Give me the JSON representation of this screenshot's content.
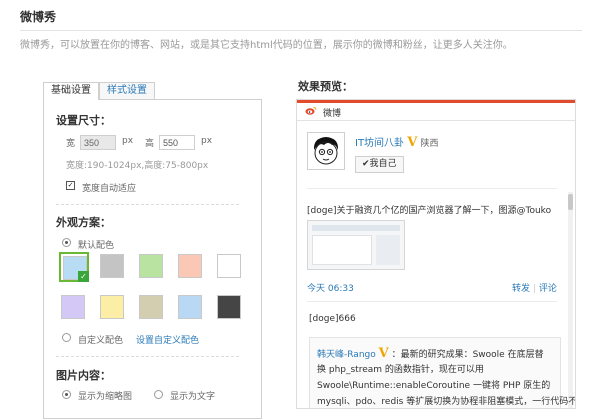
{
  "page": {
    "title": "微博秀",
    "description": "微博秀，可以放置在你的博客、网站，或是其它支持html代码的位置，展示你的微博和粉丝，让更多人关注你。"
  },
  "tabs": [
    {
      "label": "基础设置",
      "active": true
    },
    {
      "label": "样式设置",
      "active": false
    }
  ],
  "size": {
    "title": "设置尺寸：",
    "width_label": "宽",
    "width_value": "350",
    "height_label": "高",
    "height_value": "550",
    "unit": "px",
    "range_hint": "宽度:190-1024px,高度:75-800px",
    "auto_width_label": "宽度自动适应",
    "auto_width_checked": true
  },
  "appearance": {
    "title": "外观方案：",
    "default_label": "默认配色",
    "custom_label": "自定义配色",
    "custom_link": "设置自定义配色",
    "selected": "default",
    "swatches": [
      "#b7dcf4",
      "#c4c4c4",
      "#b9e3a1",
      "#fbc8b6",
      "#ffffff",
      "#d4c8f6",
      "#fdeea5",
      "#d4ceb1",
      "#b9d8f3",
      "#454545"
    ],
    "selected_swatch": 0,
    "check_mark": "✓"
  },
  "images": {
    "title": "图片内容：",
    "thumb_label": "显示为缩略图",
    "text_label": "显示为文字",
    "selected": "thumb"
  },
  "preview": {
    "label": "效果预览：",
    "header": "微博",
    "user_name": "IT坊间八卦",
    "verified_badge": "V",
    "location": "陕西",
    "follow_button": "我自己",
    "post1_text": "[doge]关于融资几个亿的国产浏览器了解一下，图源@Touko",
    "post1_time": "今天 06:33",
    "post_actions": [
      "转发",
      "评论"
    ],
    "action_separator": "|",
    "post2_text": "[doge]666",
    "quote_user": "韩天峰-Rango",
    "quote_lines": [
      "：最新的研究成果：Swoole 在底层替",
      "换 php_stream 的函数指针，现在可以用",
      "Swoole\\Runtime::enableCoroutine 一键将 PHP 原生的",
      "mysqli、pdo、redis 等扩展切换为协程非阻塞模式，一行代码不"
    ]
  },
  "colors": {
    "accent": "#2a7ab8",
    "weibo_red": "#e34b2f",
    "verified": "#f0a500",
    "selected_border": "#6ab936"
  }
}
